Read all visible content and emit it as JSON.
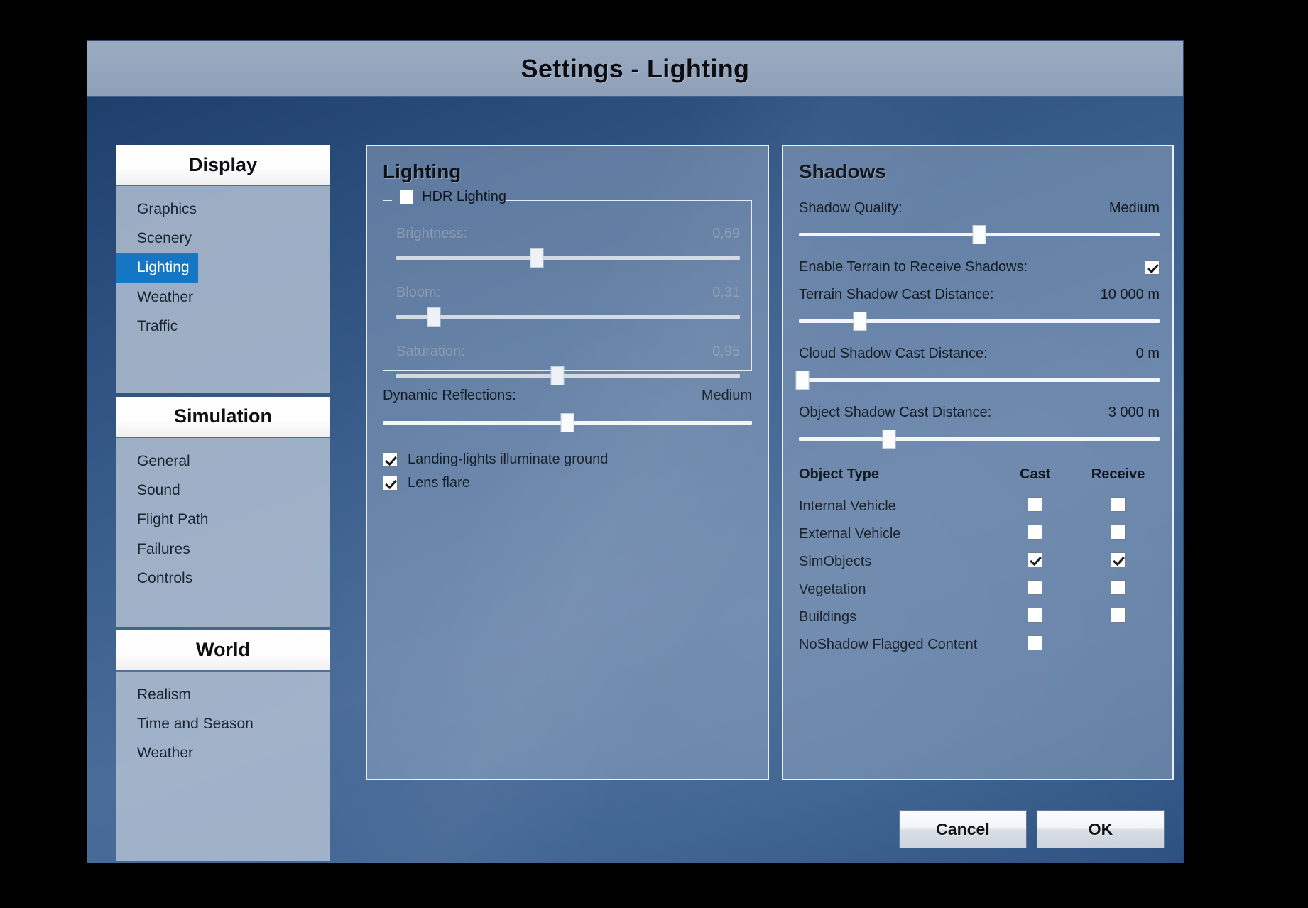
{
  "window": {
    "title": "Settings - Lighting"
  },
  "sidebar": {
    "groups": [
      {
        "header": "Display",
        "items": [
          {
            "label": "Graphics",
            "selected": false
          },
          {
            "label": "Scenery",
            "selected": false
          },
          {
            "label": "Lighting",
            "selected": true
          },
          {
            "label": "Weather",
            "selected": false
          },
          {
            "label": "Traffic",
            "selected": false
          }
        ]
      },
      {
        "header": "Simulation",
        "items": [
          {
            "label": "General",
            "selected": false
          },
          {
            "label": "Sound",
            "selected": false
          },
          {
            "label": "Flight Path",
            "selected": false
          },
          {
            "label": "Failures",
            "selected": false
          },
          {
            "label": "Controls",
            "selected": false
          }
        ]
      },
      {
        "header": "World",
        "items": [
          {
            "label": "Realism",
            "selected": false
          },
          {
            "label": "Time and Season",
            "selected": false
          },
          {
            "label": "Weather",
            "selected": false
          }
        ]
      }
    ]
  },
  "lighting": {
    "title": "Lighting",
    "hdr": {
      "label": "HDR Lighting",
      "checked": false
    },
    "sliders": [
      {
        "label": "Brightness:",
        "value": "0,69",
        "pos": 41,
        "disabled": true
      },
      {
        "label": "Bloom:",
        "value": "0,31",
        "pos": 11,
        "disabled": true
      },
      {
        "label": "Saturation:",
        "value": "0,95",
        "pos": 47,
        "disabled": true
      }
    ],
    "dynamic_reflections": {
      "label": "Dynamic Reflections:",
      "value": "Medium",
      "pos": 50,
      "disabled": false
    },
    "checkboxes": [
      {
        "label": "Landing-lights illuminate ground",
        "checked": true
      },
      {
        "label": "Lens flare",
        "checked": true
      }
    ]
  },
  "shadows": {
    "title": "Shadows",
    "rows": [
      {
        "label": "Shadow Quality:",
        "value": "Medium",
        "type": "slider",
        "pos": 50
      },
      {
        "label": "Enable Terrain to Receive Shadows:",
        "value": "",
        "type": "checkbox",
        "checked": true
      },
      {
        "label": "Terrain Shadow Cast Distance:",
        "value": "10 000 m",
        "type": "slider",
        "pos": 17
      },
      {
        "label": "Cloud Shadow Cast Distance:",
        "value": "0 m",
        "type": "slider",
        "pos": 1
      },
      {
        "label": "Object Shadow Cast Distance:",
        "value": "3 000 m",
        "type": "slider",
        "pos": 25
      }
    ],
    "table": {
      "headers": {
        "type": "Object Type",
        "cast": "Cast",
        "receive": "Receive"
      },
      "rows": [
        {
          "type": "Internal Vehicle",
          "cast": false,
          "receive": false,
          "has_receive": true
        },
        {
          "type": "External Vehicle",
          "cast": false,
          "receive": false,
          "has_receive": true
        },
        {
          "type": "SimObjects",
          "cast": true,
          "receive": true,
          "has_receive": true
        },
        {
          "type": "Vegetation",
          "cast": false,
          "receive": false,
          "has_receive": true
        },
        {
          "type": "Buildings",
          "cast": false,
          "receive": false,
          "has_receive": true
        },
        {
          "type": "NoShadow Flagged Content",
          "cast": false,
          "receive": false,
          "has_receive": false
        }
      ]
    }
  },
  "footer": {
    "cancel": "Cancel",
    "ok": "OK"
  },
  "colors": {
    "accent_selected": "#1577c4",
    "title_bar": "#94a6bd",
    "panel_border": "#e9eef5"
  }
}
